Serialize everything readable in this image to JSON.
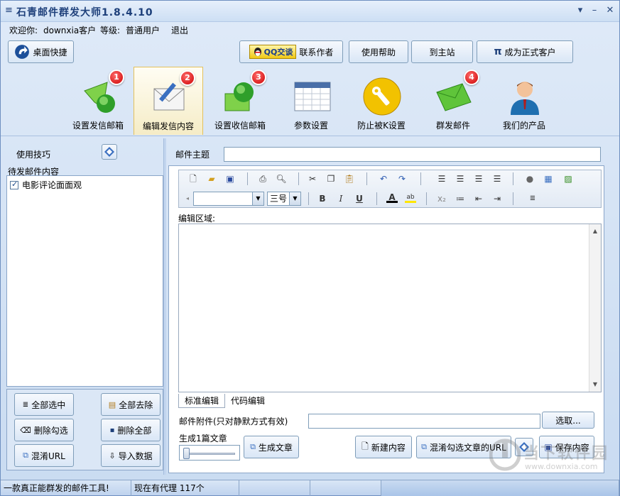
{
  "app": {
    "title": "石青邮件群发大师1.8.4.10"
  },
  "welcome": {
    "prefix": "欢迎你:",
    "user": "downxia客户",
    "level_label": "等级:",
    "level": "普通用户",
    "logout": "退出"
  },
  "top_buttons": {
    "desktop": "桌面快捷",
    "qq": "QQ交谈",
    "contact": "联系作者",
    "help": "使用帮助",
    "home": "到主站",
    "upgrade": "成为正式客户"
  },
  "nav": [
    {
      "label": "设置发信邮箱",
      "badge": "1"
    },
    {
      "label": "编辑发信内容",
      "badge": "2"
    },
    {
      "label": "设置收信邮箱",
      "badge": "3"
    },
    {
      "label": "参数设置",
      "badge": ""
    },
    {
      "label": "防止被K设置",
      "badge": ""
    },
    {
      "label": "群发邮件",
      "badge": "4"
    },
    {
      "label": "我们的产品",
      "badge": ""
    }
  ],
  "left": {
    "tips": "使用技巧",
    "pending": "待发邮件内容",
    "items": [
      "电影评论面面观"
    ],
    "buttons": {
      "select_all": "全部选中",
      "remove_all": "全部去除",
      "delete_checked": "删除勾选",
      "delete_all": "删除全部",
      "mix_url": "混淆URL",
      "import": "导入数据"
    }
  },
  "editor": {
    "subject_label": "邮件主题",
    "subject_value": "",
    "font_size": "三号",
    "area_label": "编辑区域:",
    "tabs": [
      "标准编辑",
      "代码编辑"
    ],
    "attach_label": "邮件附件(只对静默方式有效)",
    "attach_value": "",
    "browse": "选取...",
    "gen_label": "生成1篇文章",
    "gen_button": "生成文章",
    "new_button": "新建内容",
    "mix_button": "混淆勾选文章的URL",
    "save_button": "保存内容"
  },
  "status": {
    "left": "一款真正能群发的邮件工具!",
    "proxy": "现在有代理 117个"
  },
  "watermark": {
    "big": "当下软件园",
    "small": "www.downxia.com"
  },
  "colors": {
    "accent": "#1d3f7a",
    "badge": "#cc0000",
    "active_tab": "#f5ecc6"
  }
}
